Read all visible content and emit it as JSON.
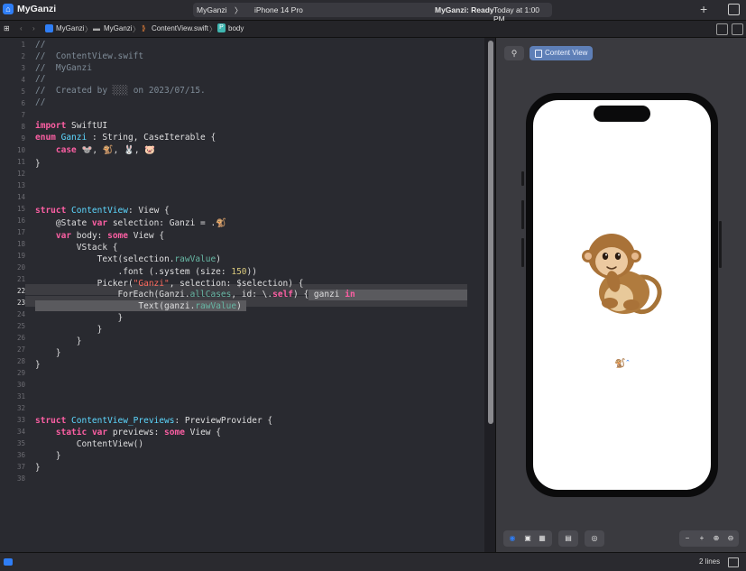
{
  "window": {
    "app_title": "MyGanzi"
  },
  "toolbar": {
    "scheme_project": "MyGanzi",
    "scheme_sep": "〉",
    "scheme_device": "iPhone 14 Pro",
    "status_label": "MyGanzi: Ready",
    "status_time": "Today at 1:00 PM"
  },
  "breadcrumb": {
    "items": [
      "MyGanzi",
      "MyGanzi",
      "ContentView.swift",
      "body"
    ],
    "sep": "〉"
  },
  "editor": {
    "line_numbers": [
      "1",
      "2",
      "3",
      "4",
      "5",
      "6",
      "7",
      "8",
      "9",
      "10",
      "11",
      "12",
      "13",
      "14",
      "15",
      "16",
      "17",
      "18",
      "19",
      "20",
      "21",
      "22",
      "23",
      "24",
      "25",
      "26",
      "27",
      "28",
      "29",
      "30",
      "31",
      "32",
      "33",
      "34",
      "35",
      "36",
      "37",
      "38"
    ],
    "current_lines": [
      "22",
      "23"
    ],
    "code": {
      "l1": "//",
      "l2": "//  ContentView.swift",
      "l3": "//  MyGanzi",
      "l4": "//",
      "l5a": "//  Created by ",
      "l5b": "░░░",
      "l5c": " on 2023/07/15.",
      "l6": "//",
      "l8a": "import",
      "l8b": " SwiftUI",
      "l9a": "enum",
      "l9b": " Ganzi",
      "l9c": " : String, CaseIterable {",
      "l10a": "    ",
      "l10b": "case",
      "l10c": " 🐭, 🐒, 🐰, 🐷",
      "l11": "}",
      "l15a": "struct",
      "l15b": " ContentView",
      "l15c": ": View {",
      "l16a": "    @State",
      "l16b": " var",
      "l16c": " selection: Ganzi = .🐒",
      "l17a": "    ",
      "l17b": "var",
      "l17c": " body: ",
      "l17d": "some",
      "l17e": " View {",
      "l18": "        VStack {",
      "l19a": "            Text(selection.",
      "l19b": "rawValue",
      "l19c": ")",
      "l20a": "                .font (.system (size: ",
      "l20b": "150",
      "l20c": "))",
      "l21a": "            Picker(",
      "l21b": "\"Ganzi\"",
      "l21c": ", selection: $selection) {",
      "l22a": "                ForEach(Ganzi.",
      "l22b": "allCases",
      "l22c": ", id: \\.",
      "l22d": "self",
      "l22e": ") { ganzi ",
      "l22f": "in",
      "l23a": "                    Text(ganzi.",
      "l23b": "rawValue",
      "l23c": ")",
      "l24": "                }",
      "l25": "            }",
      "l26": "        }",
      "l27": "    }",
      "l28": "}",
      "l33a": "struct",
      "l33b": " ContentView_Previews",
      "l33c": ": PreviewProvider {",
      "l34a": "    ",
      "l34b": "static",
      "l34c": " var",
      "l34d": " previews: ",
      "l34e": "some",
      "l34f": " View {",
      "l35": "        ContentView()",
      "l36": "    }",
      "l37": "}"
    }
  },
  "canvas": {
    "pin_label": "⚲",
    "content_view_label": "Content View",
    "preview_emoji": "🐒",
    "picker_emoji": "🐒",
    "picker_chevron": "⌃"
  },
  "canvas_controls": {
    "live_icon": "◉",
    "select_icon": "▣",
    "grid_icon": "▦",
    "variants_icon": "▤",
    "device_icon": "◎",
    "zoom_out": "−",
    "zoom_in": "+",
    "zoom_fit": "⊕",
    "zoom_actual": "⊖"
  },
  "statusbar": {
    "lines": "2 lines"
  },
  "colors": {
    "accent": "#2f7ef6",
    "keyword": "#fc5fa3",
    "type": "#5dd8ff",
    "comment": "#7f8c98",
    "string": "#fc6a5d"
  }
}
